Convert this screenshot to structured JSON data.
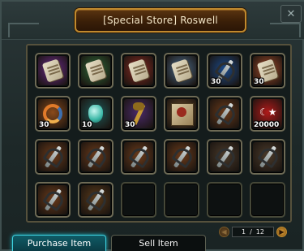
{
  "window": {
    "title": "[Special Store] Roswell",
    "close_label": "✕"
  },
  "pager": {
    "prev_label": "◀",
    "next_label": "▶",
    "current": "1",
    "separator": "/",
    "total": "12"
  },
  "tabs": {
    "purchase": "Purchase Item",
    "sell": "Sell Item"
  },
  "items": [
    {
      "icon": "purple-scroll-icon",
      "bg": "#6b2a8a",
      "kind": "scroll",
      "qty": ""
    },
    {
      "icon": "green-scroll-icon",
      "bg": "#2e6b3a",
      "kind": "scroll",
      "qty": ""
    },
    {
      "icon": "red-scroll-icon",
      "bg": "#8a2a22",
      "kind": "scroll",
      "qty": ""
    },
    {
      "icon": "blue-scroll-icon",
      "bg": "#4a6a8a",
      "kind": "scroll",
      "qty": ""
    },
    {
      "icon": "blue-potion-icon",
      "bg": "#1a4a8a",
      "kind": "weapon",
      "qty": "30"
    },
    {
      "icon": "orange-scroll-icon",
      "bg": "#a04a2a",
      "kind": "scroll",
      "qty": "30"
    },
    {
      "icon": "swirl-orb-icon",
      "bg": "#8a4a1a",
      "kind": "swirl",
      "qty": "30"
    },
    {
      "icon": "teal-gem-icon",
      "bg": "#1f5a5a",
      "kind": "gem",
      "qty": "10"
    },
    {
      "icon": "golden-scepter-icon",
      "bg": "#4a2a6a",
      "kind": "scepter",
      "qty": "30"
    },
    {
      "icon": "spell-book-icon",
      "bg": "#6a4a2a",
      "kind": "book",
      "qty": ""
    },
    {
      "icon": "crossbow-icon",
      "bg": "#6a3a1a",
      "kind": "weapon",
      "qty": ""
    },
    {
      "icon": "red-flag-icon",
      "bg": "#b01a1a",
      "kind": "flag",
      "qty": "20000"
    },
    {
      "icon": "axe-weapon-icon",
      "bg": "#6a3a1a",
      "kind": "weapon",
      "qty": ""
    },
    {
      "icon": "bow-weapon-icon",
      "bg": "#6a3a1a",
      "kind": "weapon",
      "qty": ""
    },
    {
      "icon": "spear-weapon-icon",
      "bg": "#6a3a1a",
      "kind": "weapon",
      "qty": ""
    },
    {
      "icon": "hammer-weapon-icon",
      "bg": "#6a3a1a",
      "kind": "weapon",
      "qty": ""
    },
    {
      "icon": "star-blade-icon",
      "bg": "#4a3a2a",
      "kind": "weapon",
      "qty": ""
    },
    {
      "icon": "star-blade-alt-icon",
      "bg": "#4a3a2a",
      "kind": "weapon",
      "qty": ""
    },
    {
      "icon": "chest-weapon-icon",
      "bg": "#6a3a1a",
      "kind": "weapon",
      "qty": ""
    },
    {
      "icon": "crossbow-alt-icon",
      "bg": "#5a3a1a",
      "kind": "weapon",
      "qty": ""
    }
  ],
  "empty_slots": 4
}
